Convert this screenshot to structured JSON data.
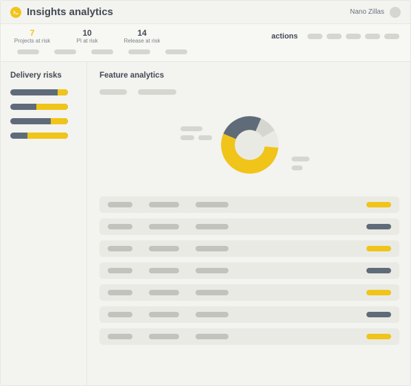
{
  "header": {
    "title": "Insights analytics",
    "user_name": "Nano Zillas"
  },
  "stats": [
    {
      "value": "7",
      "label": "Projects at risk",
      "highlight": true
    },
    {
      "value": "10",
      "label": "PI at risk",
      "highlight": false
    },
    {
      "value": "14",
      "label": "Release at risk",
      "highlight": false
    }
  ],
  "actions": {
    "label": "actions",
    "count": 5
  },
  "secondary_pills": 5,
  "sidebar": {
    "title": "Delivery risks",
    "bars": [
      {
        "yellow_pct": 18
      },
      {
        "yellow_pct": 55
      },
      {
        "yellow_pct": 30
      },
      {
        "yellow_pct": 70
      }
    ]
  },
  "content": {
    "title": "Feature analytics",
    "tabs": 2,
    "rows": [
      {
        "status": "yellow"
      },
      {
        "status": "dark"
      },
      {
        "status": "yellow"
      },
      {
        "status": "dark"
      },
      {
        "status": "yellow"
      },
      {
        "status": "dark"
      },
      {
        "status": "yellow"
      }
    ]
  },
  "chart_data": {
    "type": "pie",
    "title": "",
    "series": [
      {
        "name": "segment-a",
        "value": 55,
        "color": "#f0c419"
      },
      {
        "name": "segment-b",
        "value": 25,
        "color": "#606b79"
      },
      {
        "name": "segment-c",
        "value": 10,
        "color": "#d6d6d0"
      },
      {
        "name": "segment-d",
        "value": 10,
        "color": "#eaeae4"
      }
    ]
  }
}
